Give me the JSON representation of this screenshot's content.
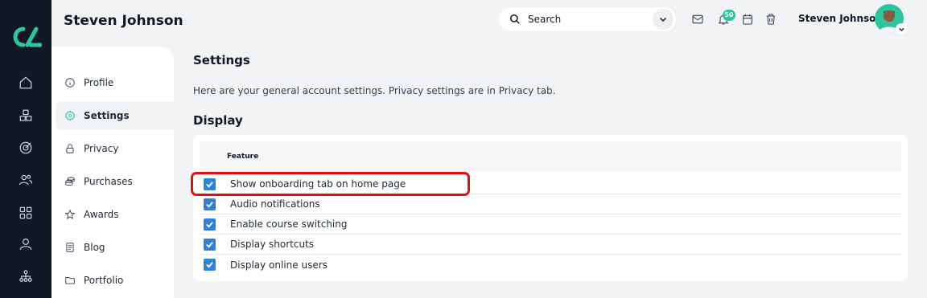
{
  "header": {
    "page_name": "Steven Johnson",
    "search_placeholder": "Search",
    "notification_count": "50",
    "user_name": "Steven Johnson"
  },
  "sidebar_nav": [
    {
      "label": "Profile",
      "icon": "info-icon",
      "active": false
    },
    {
      "label": "Settings",
      "icon": "gear-icon",
      "active": true
    },
    {
      "label": "Privacy",
      "icon": "lock-icon",
      "active": false
    },
    {
      "label": "Purchases",
      "icon": "coins-icon",
      "active": false
    },
    {
      "label": "Awards",
      "icon": "star-icon",
      "active": false
    },
    {
      "label": "Blog",
      "icon": "document-icon",
      "active": false
    },
    {
      "label": "Portfolio",
      "icon": "folder-icon",
      "active": false
    }
  ],
  "main": {
    "title": "Settings",
    "description": "Here are your general account settings. Privacy settings are in Privacy tab.",
    "section_title": "Display",
    "table_header": "Feature",
    "features": [
      {
        "label": "Show onboarding tab on home page",
        "checked": true
      },
      {
        "label": "Audio notifications",
        "checked": true
      },
      {
        "label": "Enable course switching",
        "checked": true
      },
      {
        "label": "Display shortcuts",
        "checked": true
      },
      {
        "label": "Display online users",
        "checked": true
      }
    ]
  },
  "colors": {
    "accent": "#2ec4a0",
    "rail_bg": "#111827",
    "checkbox": "#2f80d9",
    "highlight": "#e01010"
  }
}
